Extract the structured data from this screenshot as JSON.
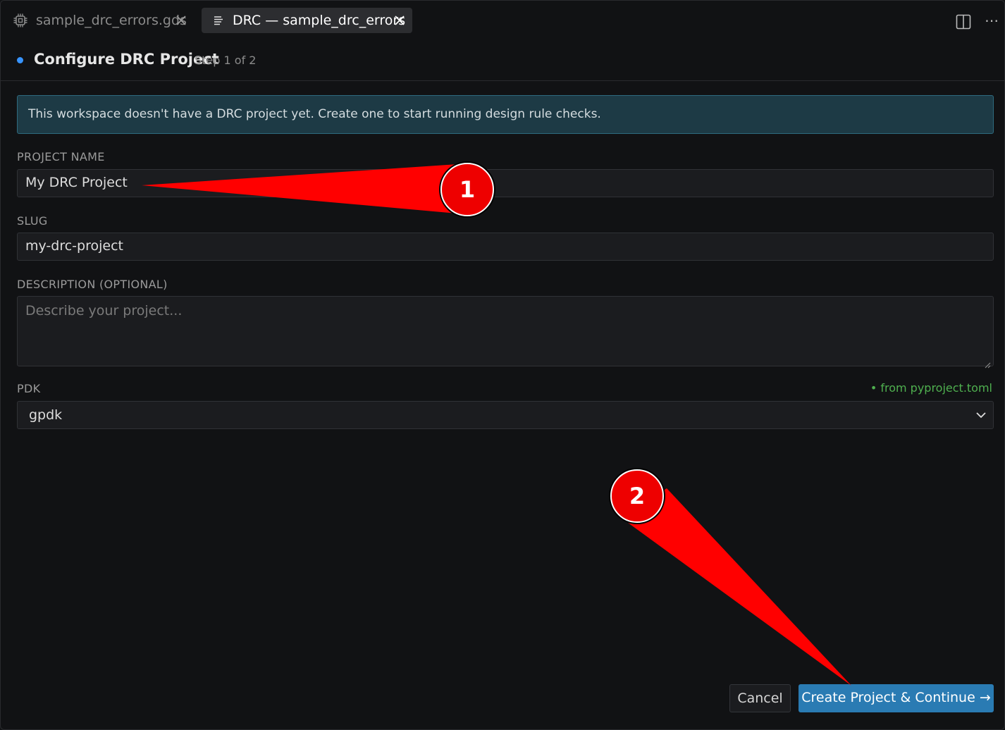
{
  "tabs": [
    {
      "label": "sample_drc_errors.gds",
      "icon": "chip-icon",
      "active": false
    },
    {
      "label": "DRC — sample_drc_errors",
      "icon": "list-icon",
      "active": true
    }
  ],
  "header": {
    "title": "Configure DRC Project",
    "step": "Step 1 of 2"
  },
  "banner": {
    "text": "This workspace doesn't have a DRC project yet. Create one to start running design rule checks."
  },
  "form": {
    "project_name": {
      "label": "PROJECT NAME",
      "value": "My DRC Project"
    },
    "slug": {
      "label": "SLUG",
      "value": "my-drc-project"
    },
    "description": {
      "label": "DESCRIPTION (OPTIONAL)",
      "placeholder": "Describe your project..."
    },
    "pdk": {
      "label": "PDK",
      "value": "gpdk",
      "source_hint": "• from pyproject.toml"
    }
  },
  "actions": {
    "cancel": "Cancel",
    "primary": "Create Project & Continue →"
  },
  "annotations": {
    "badge1": "1",
    "badge2": "2"
  },
  "colors": {
    "accent": "#2a7bb3",
    "banner_bg": "#1d3a45",
    "hint_green": "#4fb04f",
    "annotation_red": "#ee0000"
  }
}
